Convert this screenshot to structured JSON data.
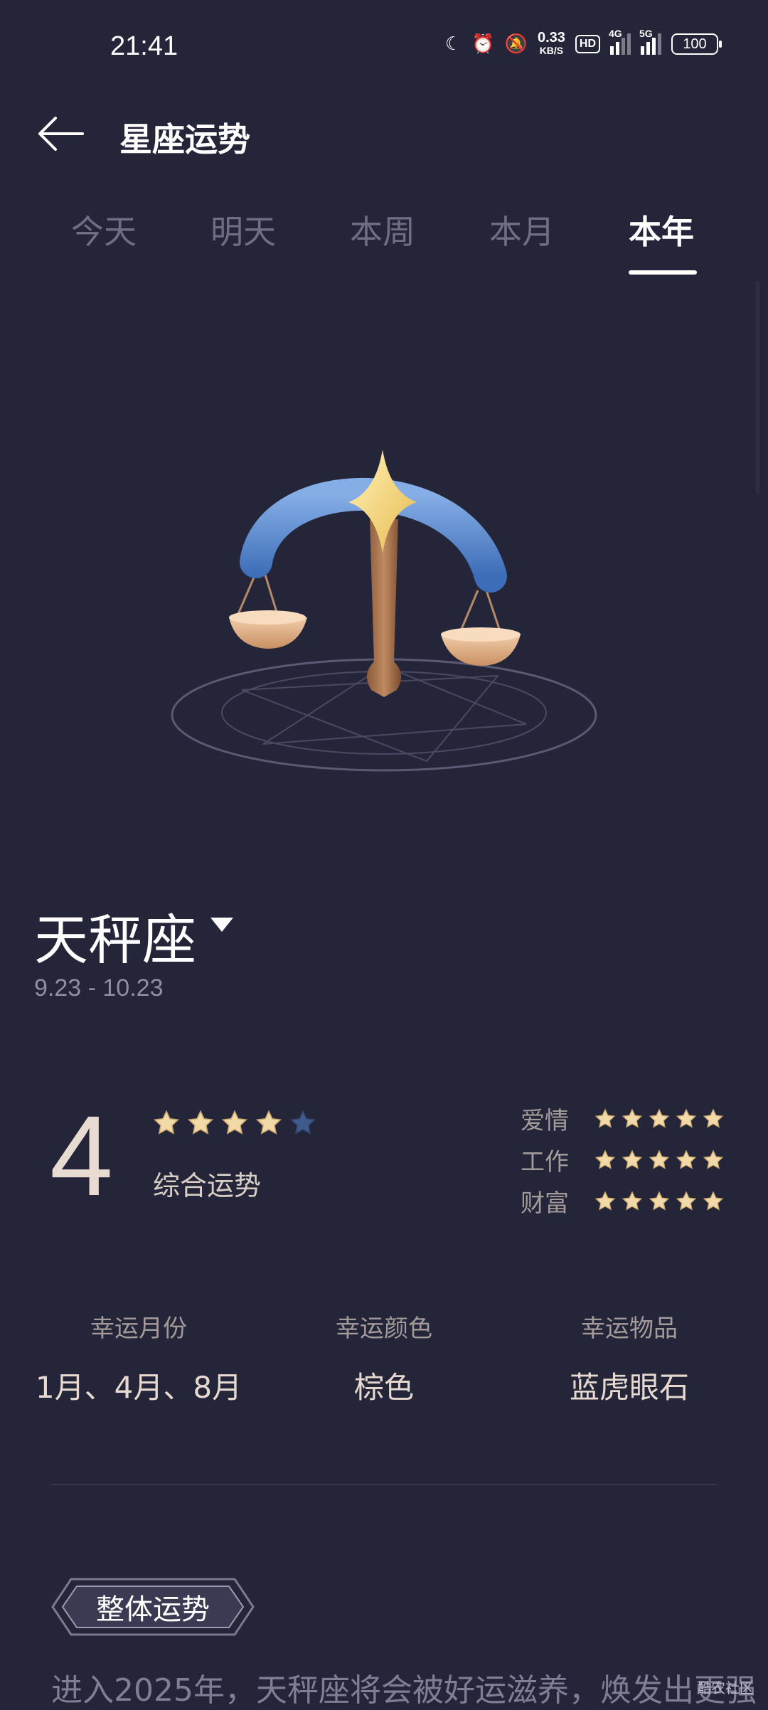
{
  "status": {
    "time": "21:41",
    "net_speed": "0.33",
    "net_unit": "KB/S",
    "hd": "HD",
    "sig1": "4G",
    "sig2": "5G",
    "battery": "100"
  },
  "header": {
    "title": "星座运势"
  },
  "tabs": [
    {
      "label": "今天"
    },
    {
      "label": "明天"
    },
    {
      "label": "本周"
    },
    {
      "label": "本月"
    },
    {
      "label": "本年",
      "active": true
    }
  ],
  "sign": {
    "name": "天秤座",
    "dates": "9.23 - 10.23"
  },
  "fortune": {
    "score": "4",
    "overall_label": "综合运势",
    "overall_stars": 4,
    "love": {
      "label": "爱情",
      "stars": 5
    },
    "work": {
      "label": "工作",
      "stars": 5
    },
    "wealth": {
      "label": "财富",
      "stars": 5
    }
  },
  "lucky": {
    "month": {
      "label": "幸运月份",
      "value": "1月、4月、8月"
    },
    "color": {
      "label": "幸运颜色",
      "value": "棕色"
    },
    "item": {
      "label": "幸运物品",
      "value": "蓝虎眼石"
    }
  },
  "section": {
    "title": "整体运势"
  },
  "body": {
    "text": "进入2025年，天秤座将会被好运滋养，焕发出更强"
  },
  "watermark": "酷农社区",
  "colors": {
    "background": "#25253a",
    "star_filled": "#f2d9a8",
    "star_empty": "#3f5a8c"
  }
}
